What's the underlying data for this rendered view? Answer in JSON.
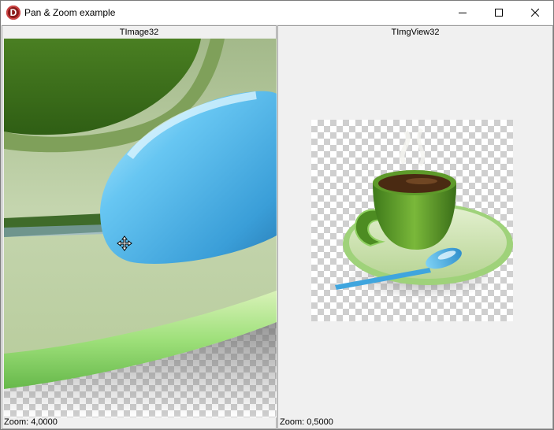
{
  "window": {
    "title": "Pan & Zoom example",
    "icon_letter": "D"
  },
  "caption_buttons": {
    "minimize_icon": "minimize-icon",
    "maximize_icon": "maximize-icon",
    "close_icon": "close-icon"
  },
  "left_panel": {
    "header": "TImage32",
    "status": "Zoom: 4,0000"
  },
  "right_panel": {
    "header": "TImgView32",
    "status": "Zoom: 0,5000"
  },
  "cursor": "move-cursor-icon",
  "colors": {
    "cup_green": "#5a9a2a",
    "spoon_blue": "#5ab8e8",
    "saucer_green": "#c9dcae",
    "coffee": "#4a2a12"
  }
}
